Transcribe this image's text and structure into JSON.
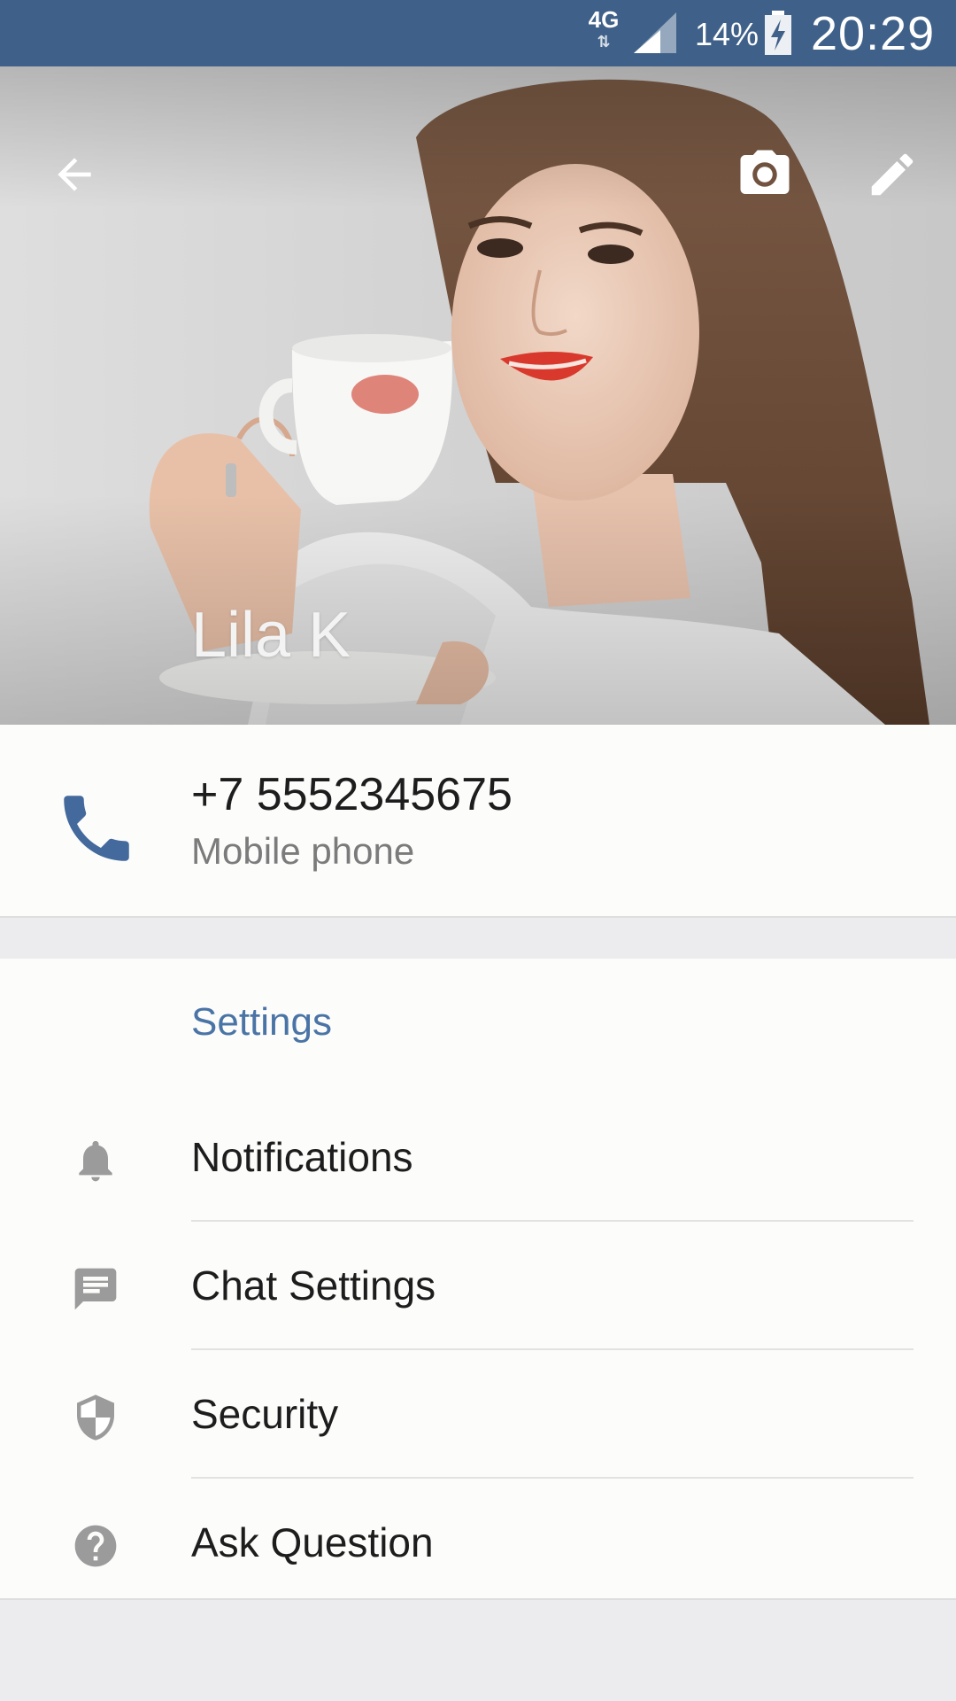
{
  "status_bar": {
    "network": "4G",
    "network_arrows": "⇅",
    "battery_percent": "14%",
    "time": "20:29"
  },
  "header": {
    "name": "Lila K",
    "icons": {
      "back": "arrow-left-icon",
      "camera": "camera-icon",
      "edit": "pencil-icon"
    }
  },
  "phone": {
    "number": "+7 5552345675",
    "type": "Mobile phone",
    "icon": "phone-icon"
  },
  "settings": {
    "header": "Settings",
    "items": [
      {
        "label": "Notifications",
        "icon": "bell-icon"
      },
      {
        "label": "Chat Settings",
        "icon": "chat-bubble-icon"
      },
      {
        "label": "Security",
        "icon": "shield-icon"
      },
      {
        "label": "Ask Question",
        "icon": "help-circle-icon"
      }
    ]
  },
  "colors": {
    "status_bar": "#3f6189",
    "accent": "#4a74a6",
    "phone_icon": "#44699c",
    "icon_gray": "#9b9b9b"
  }
}
